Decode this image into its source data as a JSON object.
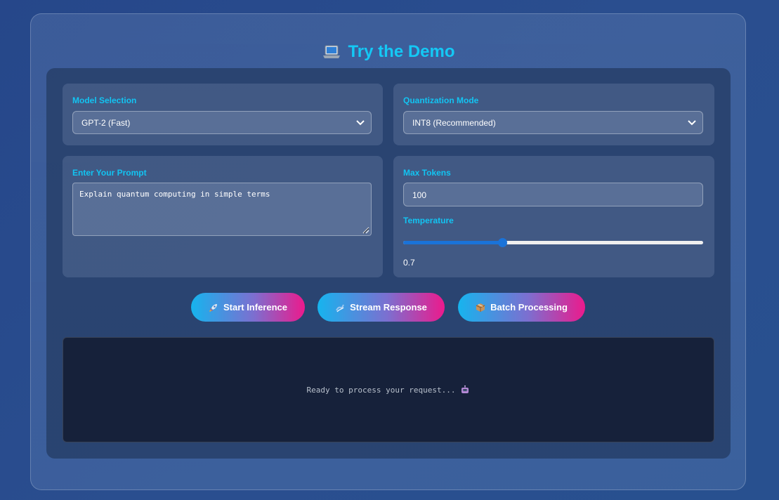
{
  "header": {
    "title": "Try the Demo",
    "icon": "laptop-icon"
  },
  "model_selection": {
    "label": "Model Selection",
    "selected": "GPT-2 (Fast)"
  },
  "quantization": {
    "label": "Quantization Mode",
    "selected": "INT8 (Recommended)"
  },
  "prompt": {
    "label": "Enter Your Prompt",
    "value": "Explain quantum computing in simple terms"
  },
  "max_tokens": {
    "label": "Max Tokens",
    "value": "100"
  },
  "temperature": {
    "label": "Temperature",
    "value": "0.7",
    "slider_fraction": 0.33
  },
  "actions": [
    {
      "label": "Start Inference",
      "icon": "rocket-icon"
    },
    {
      "label": "Stream Response",
      "icon": "wave-icon"
    },
    {
      "label": "Batch Processing",
      "icon": "package-icon"
    }
  ],
  "output": {
    "text": "Ready to process your request...",
    "icon": "robot-icon"
  },
  "colors": {
    "accent": "#14c8f5",
    "slider": "#1a73d9",
    "button_gradient_start": "#16b4ee",
    "button_gradient_end": "#ec1a8c"
  }
}
